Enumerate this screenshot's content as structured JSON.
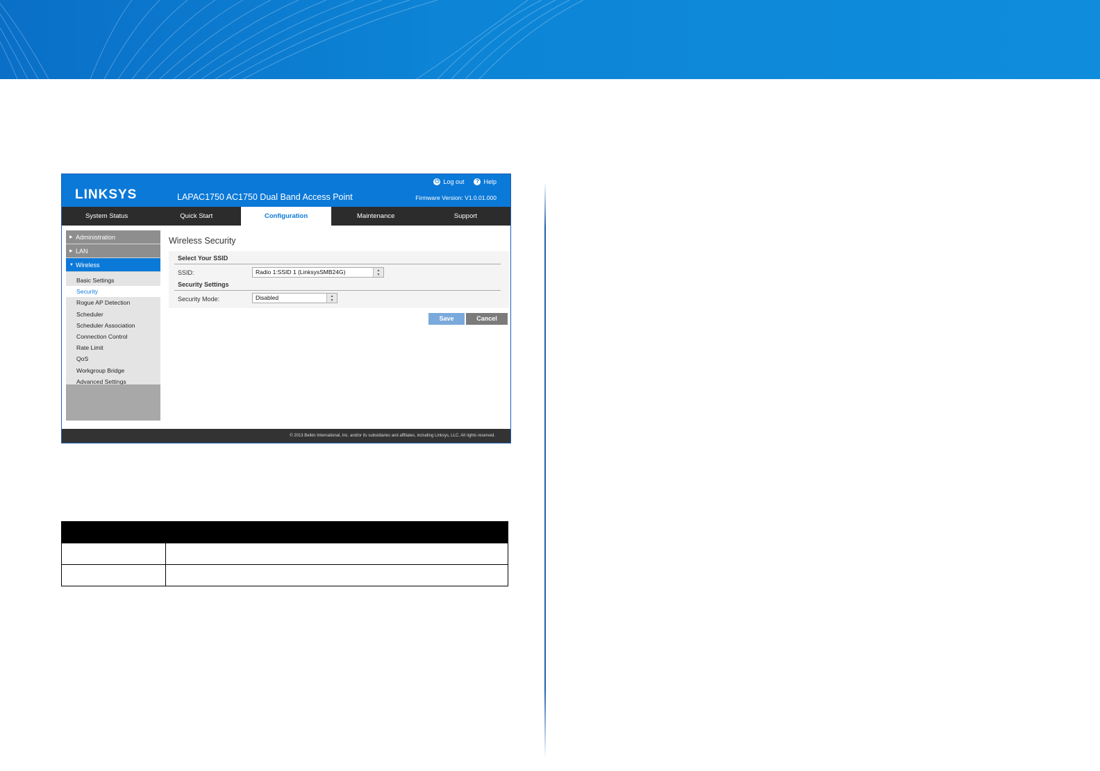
{
  "window": {
    "logo_text": "LINKSYS",
    "product_title": "LAPAC1750 AC1750 Dual Band Access Point",
    "firmware": "Firmware Version: V1.0.01.000",
    "logout_label": "Log out",
    "help_label": "Help"
  },
  "nav": {
    "tabs": [
      {
        "label": "System Status"
      },
      {
        "label": "Quick Start"
      },
      {
        "label": "Configuration",
        "active": true
      },
      {
        "label": "Maintenance"
      },
      {
        "label": "Support"
      }
    ]
  },
  "sidebar": {
    "sections": [
      {
        "label": "Administration"
      },
      {
        "label": "LAN"
      },
      {
        "label": "Wireless",
        "active": true
      }
    ],
    "items": [
      {
        "label": "Basic Settings"
      },
      {
        "label": "Security",
        "active": true
      },
      {
        "label": "Rogue AP Detection"
      },
      {
        "label": "Scheduler"
      },
      {
        "label": "Scheduler Association"
      },
      {
        "label": "Connection Control"
      },
      {
        "label": "Rate Limit"
      },
      {
        "label": "QoS"
      },
      {
        "label": "Workgroup Bridge"
      },
      {
        "label": "Advanced Settings"
      }
    ]
  },
  "main": {
    "title": "Wireless Security",
    "ssid_section": "Select Your SSID",
    "ssid_label": "SSID:",
    "ssid_value": "Radio 1:SSID 1 (LinksysSMB24G)",
    "security_section": "Security Settings",
    "security_mode_label": "Security Mode:",
    "security_mode_value": "Disabled",
    "save_label": "Save",
    "cancel_label": "Cancel"
  },
  "footer": {
    "copyright": "© 2013 Belkin International, Inc. and/or its subsidiaries and affiliates, including Linksys, LLC. All rights reserved."
  },
  "colors": {
    "brand_blue": "#0b79d8",
    "nav_dark": "#2c2c2c",
    "save_button": "#7aa9dc",
    "cancel_button": "#7b7b7b"
  }
}
